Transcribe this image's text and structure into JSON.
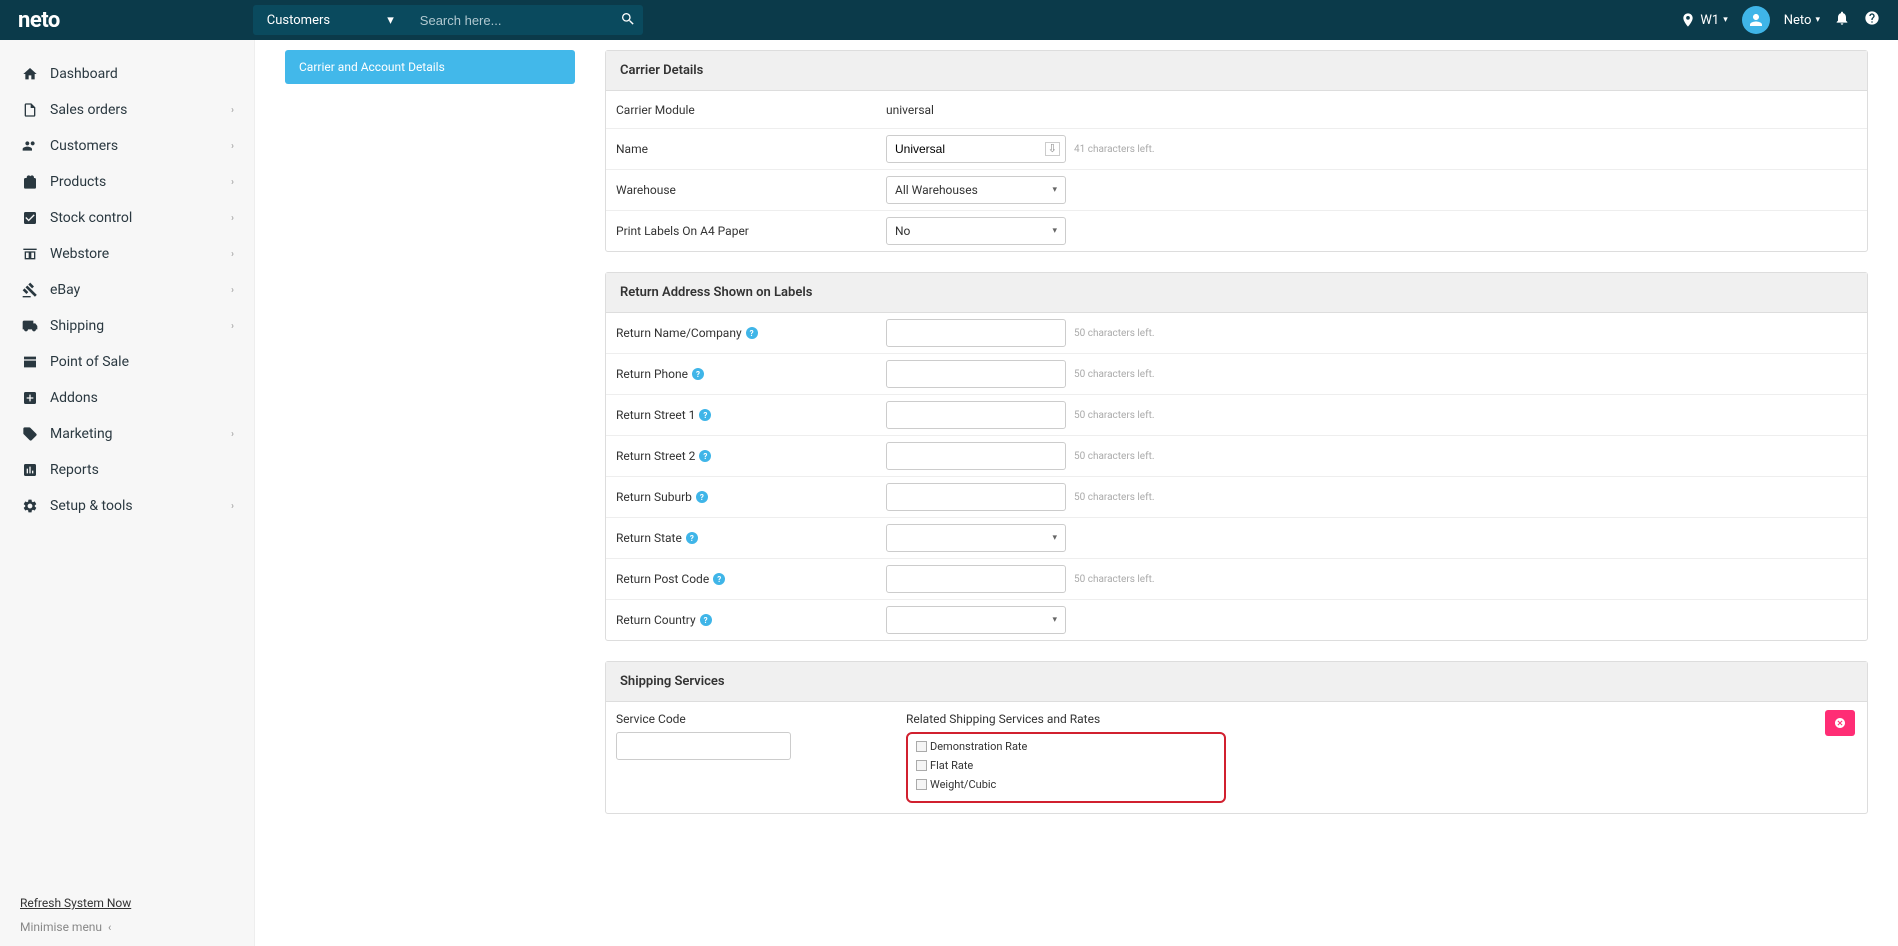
{
  "header": {
    "logo": "neto",
    "search_context": "Customers",
    "search_placeholder": "Search here...",
    "location": "W1",
    "user": "Neto"
  },
  "sidebar": {
    "items": [
      {
        "label": "Dashboard",
        "icon": "home",
        "expandable": false
      },
      {
        "label": "Sales orders",
        "icon": "file",
        "expandable": true
      },
      {
        "label": "Customers",
        "icon": "people",
        "expandable": true
      },
      {
        "label": "Products",
        "icon": "gift",
        "expandable": true
      },
      {
        "label": "Stock control",
        "icon": "check",
        "expandable": true
      },
      {
        "label": "Webstore",
        "icon": "store",
        "expandable": true
      },
      {
        "label": "eBay",
        "icon": "gavel",
        "expandable": true
      },
      {
        "label": "Shipping",
        "icon": "truck",
        "expandable": true
      },
      {
        "label": "Point of Sale",
        "icon": "pos",
        "expandable": false
      },
      {
        "label": "Addons",
        "icon": "plus",
        "expandable": false
      },
      {
        "label": "Marketing",
        "icon": "tag",
        "expandable": true
      },
      {
        "label": "Reports",
        "icon": "chart",
        "expandable": false
      },
      {
        "label": "Setup & tools",
        "icon": "gear",
        "expandable": true
      }
    ],
    "refresh": "Refresh System Now",
    "minimise": "Minimise menu"
  },
  "subnav": {
    "active": "Carrier and Account Details"
  },
  "panels": {
    "carrier": {
      "title": "Carrier Details",
      "module_label": "Carrier Module",
      "module_value": "universal",
      "name_label": "Name",
      "name_value": "Universal",
      "name_hint": "41 characters left.",
      "warehouse_label": "Warehouse",
      "warehouse_value": "All Warehouses",
      "print_label": "Print Labels On A4 Paper",
      "print_value": "No"
    },
    "return": {
      "title": "Return Address Shown on Labels",
      "rows": [
        {
          "label": "Return Name/Company",
          "hint": "50 characters left.",
          "type": "text"
        },
        {
          "label": "Return Phone",
          "hint": "50 characters left.",
          "type": "text"
        },
        {
          "label": "Return Street 1",
          "hint": "50 characters left.",
          "type": "text"
        },
        {
          "label": "Return Street 2",
          "hint": "50 characters left.",
          "type": "text"
        },
        {
          "label": "Return Suburb",
          "hint": "50 characters left.",
          "type": "text"
        },
        {
          "label": "Return State",
          "hint": "",
          "type": "select"
        },
        {
          "label": "Return Post Code",
          "hint": "50 characters left.",
          "type": "text"
        },
        {
          "label": "Return Country",
          "hint": "",
          "type": "select"
        }
      ]
    },
    "shipping": {
      "title": "Shipping Services",
      "service_code_label": "Service Code",
      "related_label": "Related Shipping Services and Rates",
      "checks": [
        "Demonstration Rate",
        "Flat Rate",
        "Weight/Cubic"
      ]
    }
  }
}
